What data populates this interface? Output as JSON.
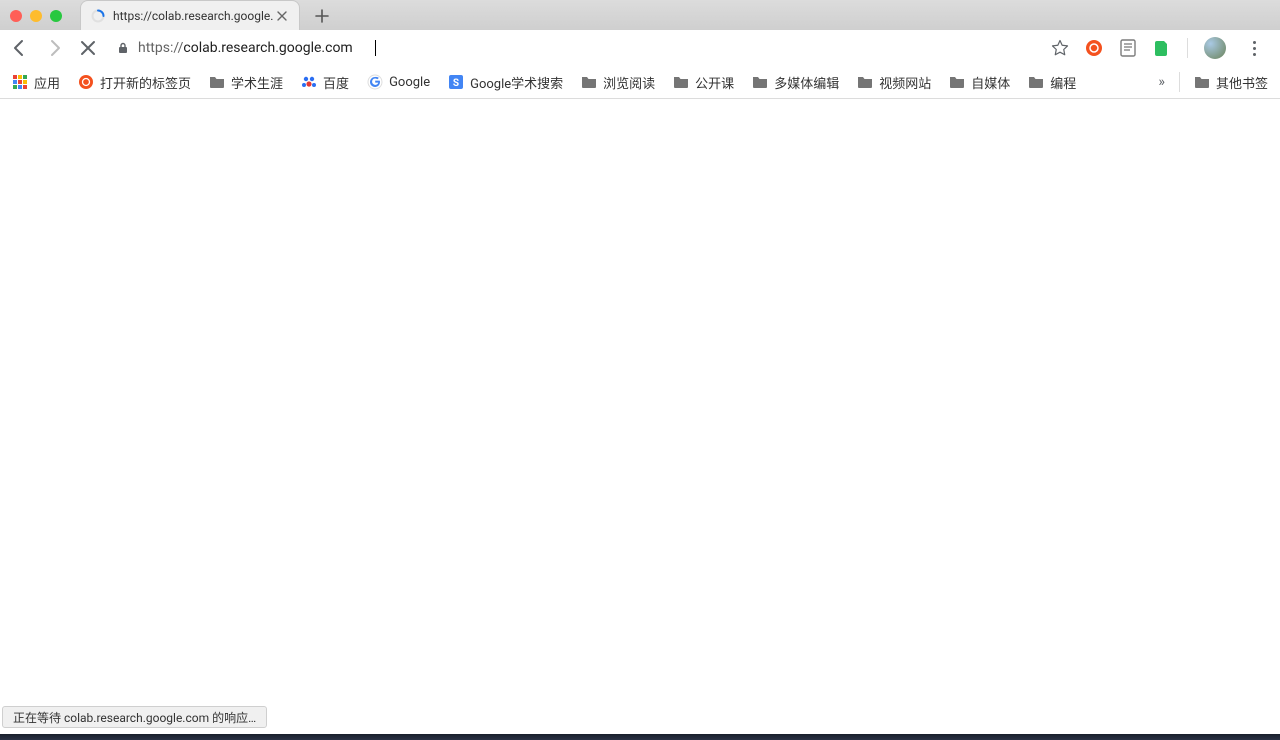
{
  "tab": {
    "title": "https://colab.research.google."
  },
  "address": {
    "scheme": "https://",
    "host": "colab.research.google.com",
    "rest": ""
  },
  "bookmarks": {
    "apps": "应用",
    "items": [
      "打开新的标签页",
      "学术生涯",
      "百度",
      "Google",
      "Google学术搜索",
      "浏览阅读",
      "公开课",
      "多媒体编辑",
      "视频网站",
      "自媒体",
      "编程"
    ],
    "other": "其他书签"
  },
  "status": "正在等待 colab.research.google.com 的响应…"
}
